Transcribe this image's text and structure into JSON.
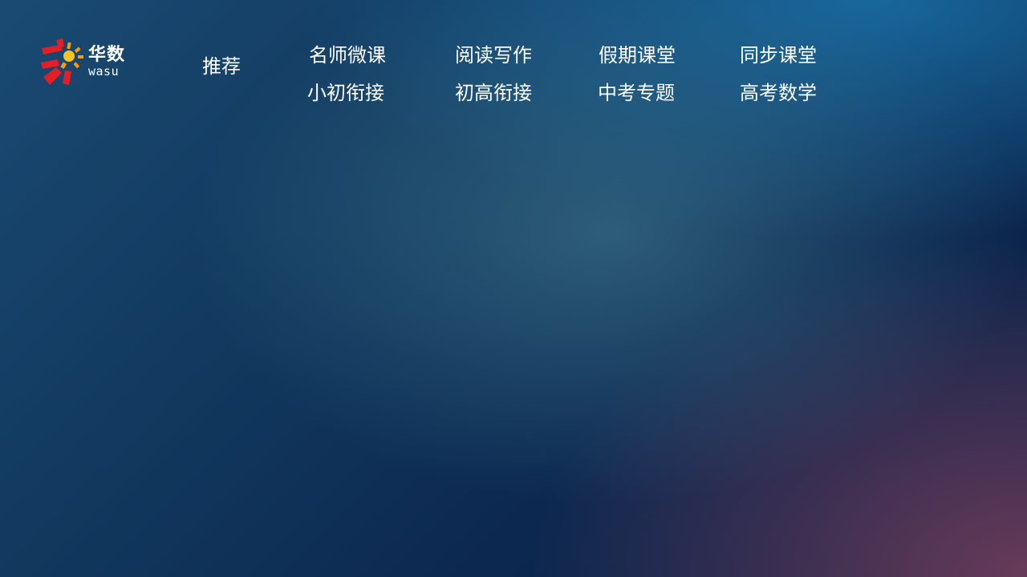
{
  "logo": {
    "name_cn": "华数",
    "name_en": "wasu",
    "icon": "wasu-sun-logo-icon",
    "colors": {
      "red": "#e21f26",
      "orange": "#f39c12",
      "yellow": "#f7c61e"
    }
  },
  "nav": {
    "recommend": "推荐",
    "row1": [
      "名师微课",
      "阅读写作",
      "假期课堂",
      "同步课堂"
    ],
    "row2": [
      "小初衔接",
      "初高衔接",
      "中考专题",
      "高考数学"
    ]
  },
  "theme": {
    "background_top_right": "#1a6592",
    "background_bottom_left": "#0a1f45",
    "background_bottom_right": "#5c4462",
    "text": "#ffffff"
  }
}
